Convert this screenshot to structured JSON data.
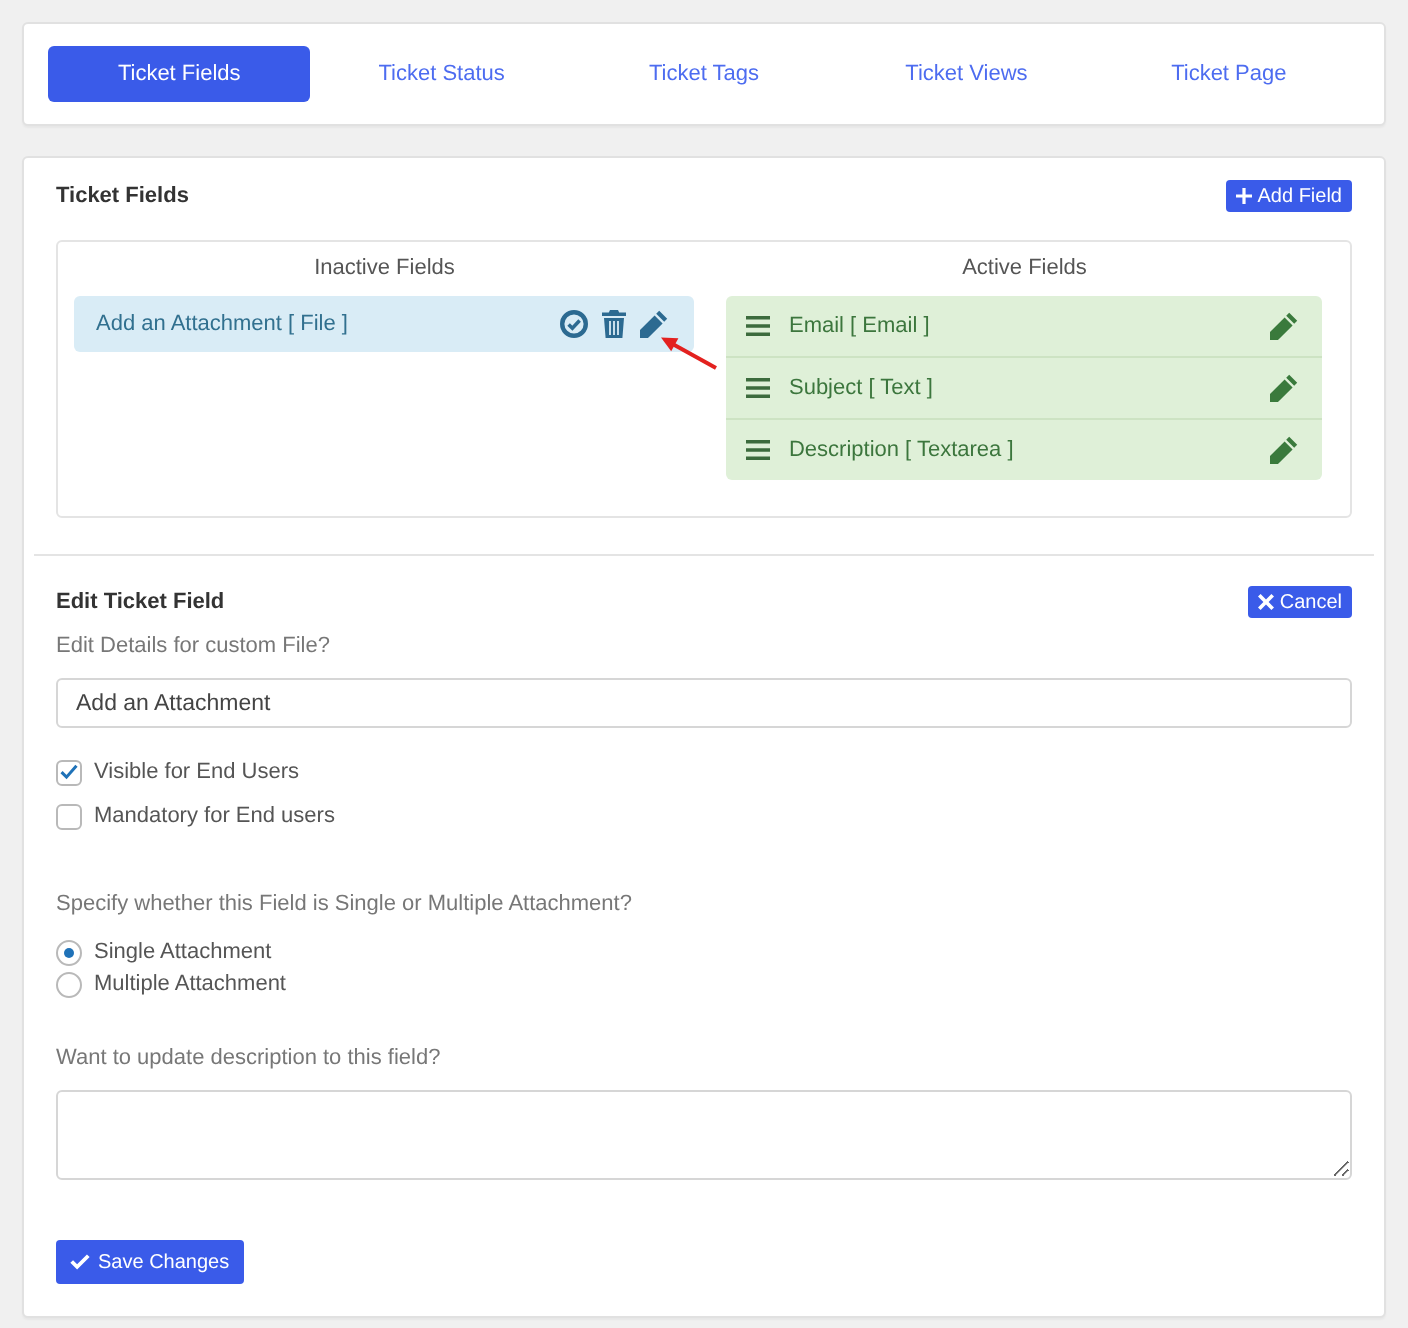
{
  "tabs": [
    {
      "label": "Ticket Fields",
      "selected": true
    },
    {
      "label": "Ticket Status",
      "selected": false
    },
    {
      "label": "Ticket Tags",
      "selected": false
    },
    {
      "label": "Ticket Views",
      "selected": false
    },
    {
      "label": "Ticket Page",
      "selected": false
    }
  ],
  "ticket_fields": {
    "title": "Ticket Fields",
    "add_button": "Add Field",
    "inactive": {
      "heading": "Inactive Fields",
      "items": [
        {
          "label": "Add an Attachment [ File ]"
        }
      ]
    },
    "active": {
      "heading": "Active Fields",
      "items": [
        {
          "label": "Email [ Email ]"
        },
        {
          "label": "Subject [ Text ]"
        },
        {
          "label": "Description [ Textarea ]"
        }
      ]
    }
  },
  "edit_field": {
    "title": "Edit Ticket Field",
    "cancel_button": "Cancel",
    "name_label": "Edit Details for custom File?",
    "name_value": "Add an Attachment",
    "checkboxes": [
      {
        "label": "Visible for End Users",
        "checked": true
      },
      {
        "label": "Mandatory for End users",
        "checked": false
      }
    ],
    "attachment_question": "Specify whether this Field is Single or Multiple Attachment?",
    "attachment_options": [
      {
        "label": "Single Attachment",
        "selected": true
      },
      {
        "label": "Multiple Attachment",
        "selected": false
      }
    ],
    "description_label": "Want to update description to this field?",
    "save_button": "Save Changes"
  }
}
